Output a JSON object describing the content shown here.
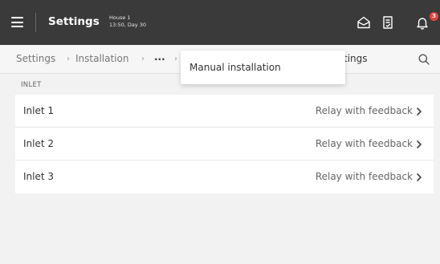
{
  "header": {
    "title": "Settings",
    "house_name": "House 1",
    "house_status": "13:50, Day 30",
    "notification_count": "3"
  },
  "breadcrumb": {
    "items": [
      "Settings",
      "Installation",
      "...",
      "tings"
    ],
    "separator": "›"
  },
  "dropdown": {
    "item": "Manual installation"
  },
  "section": {
    "title": "INLET"
  },
  "inlets": [
    {
      "label": "Inlet 1",
      "value": "Relay with feedback"
    },
    {
      "label": "Inlet 2",
      "value": "Relay with feedback"
    },
    {
      "label": "Inlet 3",
      "value": "Relay with feedback"
    }
  ],
  "icons": {
    "menu": "hamburger-menu-icon",
    "house": "house-icon",
    "report": "report-icon",
    "bell": "bell-icon",
    "search": "search-icon",
    "chevron": "chevron-right-icon"
  },
  "colors": {
    "topbar": "#3a3a3a",
    "badge": "#e8423d",
    "background": "#f2f2f2"
  }
}
